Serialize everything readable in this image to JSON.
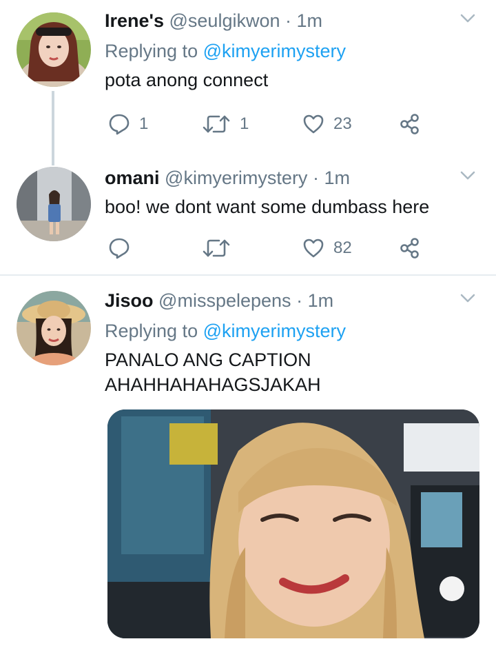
{
  "tweets": [
    {
      "name": "Irene's",
      "handle": "@seulgikwon",
      "sep": "·",
      "time": "1m",
      "replying_prefix": "Replying to",
      "replying_to": "@kimyerimystery",
      "text": "pota anong connect",
      "reply_count": "1",
      "retweet_count": "1",
      "like_count": "23"
    },
    {
      "name": "omani",
      "handle": "@kimyerimystery",
      "sep": "·",
      "time": "1m",
      "text": "boo! we dont want some dumbass here",
      "reply_count": "",
      "retweet_count": "",
      "like_count": "82"
    },
    {
      "name": "Jisoo",
      "handle": "@misspelepens",
      "sep": "·",
      "time": "1m",
      "replying_prefix": "Replying to",
      "replying_to": "@kimyerimystery",
      "text_line1": "PANALO ANG CAPTION",
      "text_line2": "AHAHHAHAHAGSJAKAH"
    }
  ],
  "colors": {
    "accent": "#1da1f2",
    "secondary_text": "#657786",
    "divider": "#e6ecf0",
    "thread_line": "#ccd6dd"
  },
  "icons": [
    "reply-icon",
    "retweet-icon",
    "like-icon",
    "share-icon",
    "chevron-down-icon"
  ]
}
